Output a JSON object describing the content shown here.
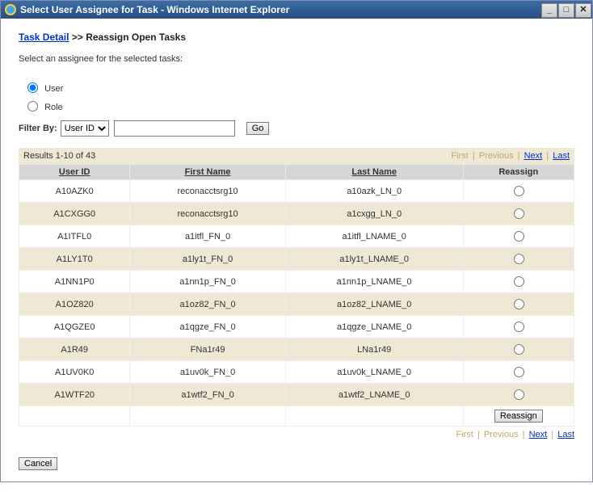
{
  "window": {
    "title": "Select User Assignee for Task - Windows Internet Explorer"
  },
  "breadcrumb": {
    "link_text": "Task Detail",
    "sep": ">>",
    "current": "Reassign Open Tasks"
  },
  "instruction": "Select an assignee for the selected tasks:",
  "assignee_type": {
    "user_label": "User",
    "role_label": "Role",
    "selected": "user"
  },
  "filter": {
    "label": "Filter By:",
    "option_selected": "User ID",
    "input_value": "",
    "go_label": "Go"
  },
  "results_summary": "Results 1-10 of 43",
  "pager": {
    "first": "First",
    "previous": "Previous",
    "next": "Next",
    "last": "Last"
  },
  "table": {
    "headers": {
      "user_id": "User ID",
      "first_name": "First Name",
      "last_name": "Last Name",
      "reassign": "Reassign"
    },
    "rows": [
      {
        "user_id": "A10AZK0",
        "first_name": "reconacctsrg10",
        "last_name": "a10azk_LN_0"
      },
      {
        "user_id": "A1CXGG0",
        "first_name": "reconacctsrg10",
        "last_name": "a1cxgg_LN_0"
      },
      {
        "user_id": "A1ITFL0",
        "first_name": "a1itfl_FN_0",
        "last_name": "a1itfl_LNAME_0"
      },
      {
        "user_id": "A1LY1T0",
        "first_name": "a1ly1t_FN_0",
        "last_name": "a1ly1t_LNAME_0"
      },
      {
        "user_id": "A1NN1P0",
        "first_name": "a1nn1p_FN_0",
        "last_name": "a1nn1p_LNAME_0"
      },
      {
        "user_id": "A1OZ820",
        "first_name": "a1oz82_FN_0",
        "last_name": "a1oz82_LNAME_0"
      },
      {
        "user_id": "A1QGZE0",
        "first_name": "a1qgze_FN_0",
        "last_name": "a1qgze_LNAME_0"
      },
      {
        "user_id": "A1R49",
        "first_name": "FNa1r49",
        "last_name": "LNa1r49"
      },
      {
        "user_id": "A1UV0K0",
        "first_name": "a1uv0k_FN_0",
        "last_name": "a1uv0k_LNAME_0"
      },
      {
        "user_id": "A1WTF20",
        "first_name": "a1wtf2_FN_0",
        "last_name": "a1wtf2_LNAME_0"
      }
    ]
  },
  "buttons": {
    "reassign": "Reassign",
    "cancel": "Cancel"
  }
}
